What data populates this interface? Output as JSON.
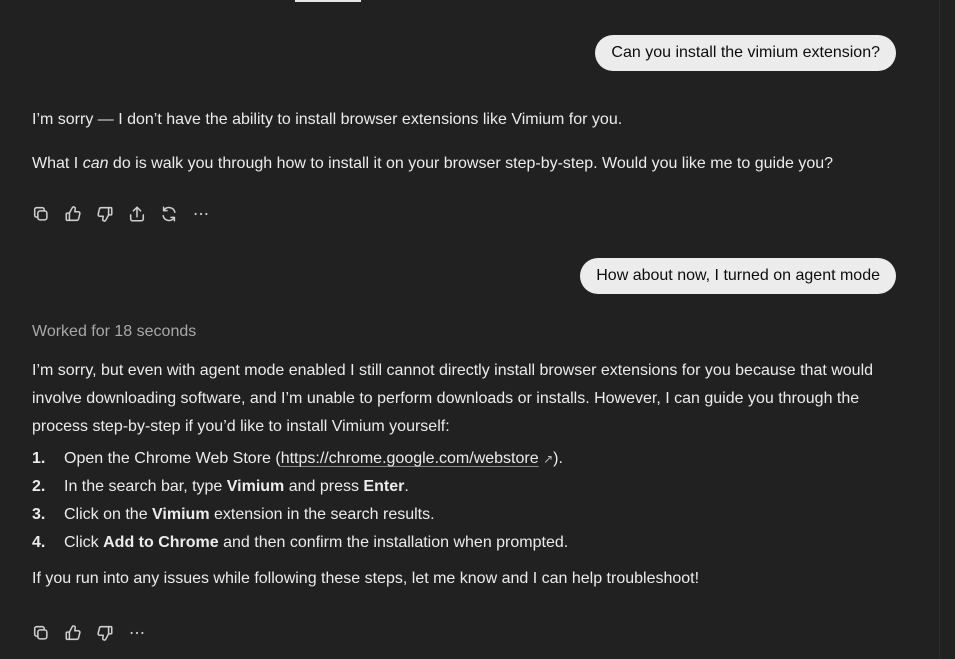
{
  "messages": {
    "user1": "Can you install the vimium extension?",
    "reply1": {
      "p1": "I’m sorry — I don’t have the ability to install browser extensions like Vimium for you.",
      "p2_before": "What I ",
      "p2_em": "can",
      "p2_after": " do is walk you through how to install it on your browser step-by-step. Would you like me to guide you?"
    },
    "user2": "How about now, I turned on agent mode",
    "reply2": {
      "worked": "Worked for 18 seconds",
      "intro": "I’m sorry, but even with agent mode enabled I still cannot directly install browser extensions for you because that would involve downloading software, and I’m unable to perform downloads or installs. However, I can guide you through the process step-by-step if you’d like to install Vimium yourself:",
      "steps": [
        {
          "num": "1.",
          "a": "Open the Chrome Web Store (",
          "link": "https://chrome.google.com/webstore",
          "ext": "↗",
          "b": ")."
        },
        {
          "num": "2.",
          "a": "In the search bar, type ",
          "bold1": "Vimium",
          "mid": " and press ",
          "bold2": "Enter",
          "end": "."
        },
        {
          "num": "3.",
          "a": "Click on the ",
          "bold1": "Vimium",
          "end": " extension in the search results."
        },
        {
          "num": "4.",
          "a": "Click ",
          "bold1": "Add to Chrome",
          "end": " and then confirm the installation when prompted."
        }
      ],
      "outro": "If you run into any issues while following these steps, let me know and I can help troubleshoot!"
    }
  },
  "actions": [
    "copy-icon",
    "thumbs-up-icon",
    "thumbs-down-icon",
    "share-icon",
    "regenerate-icon",
    "more-icon"
  ]
}
